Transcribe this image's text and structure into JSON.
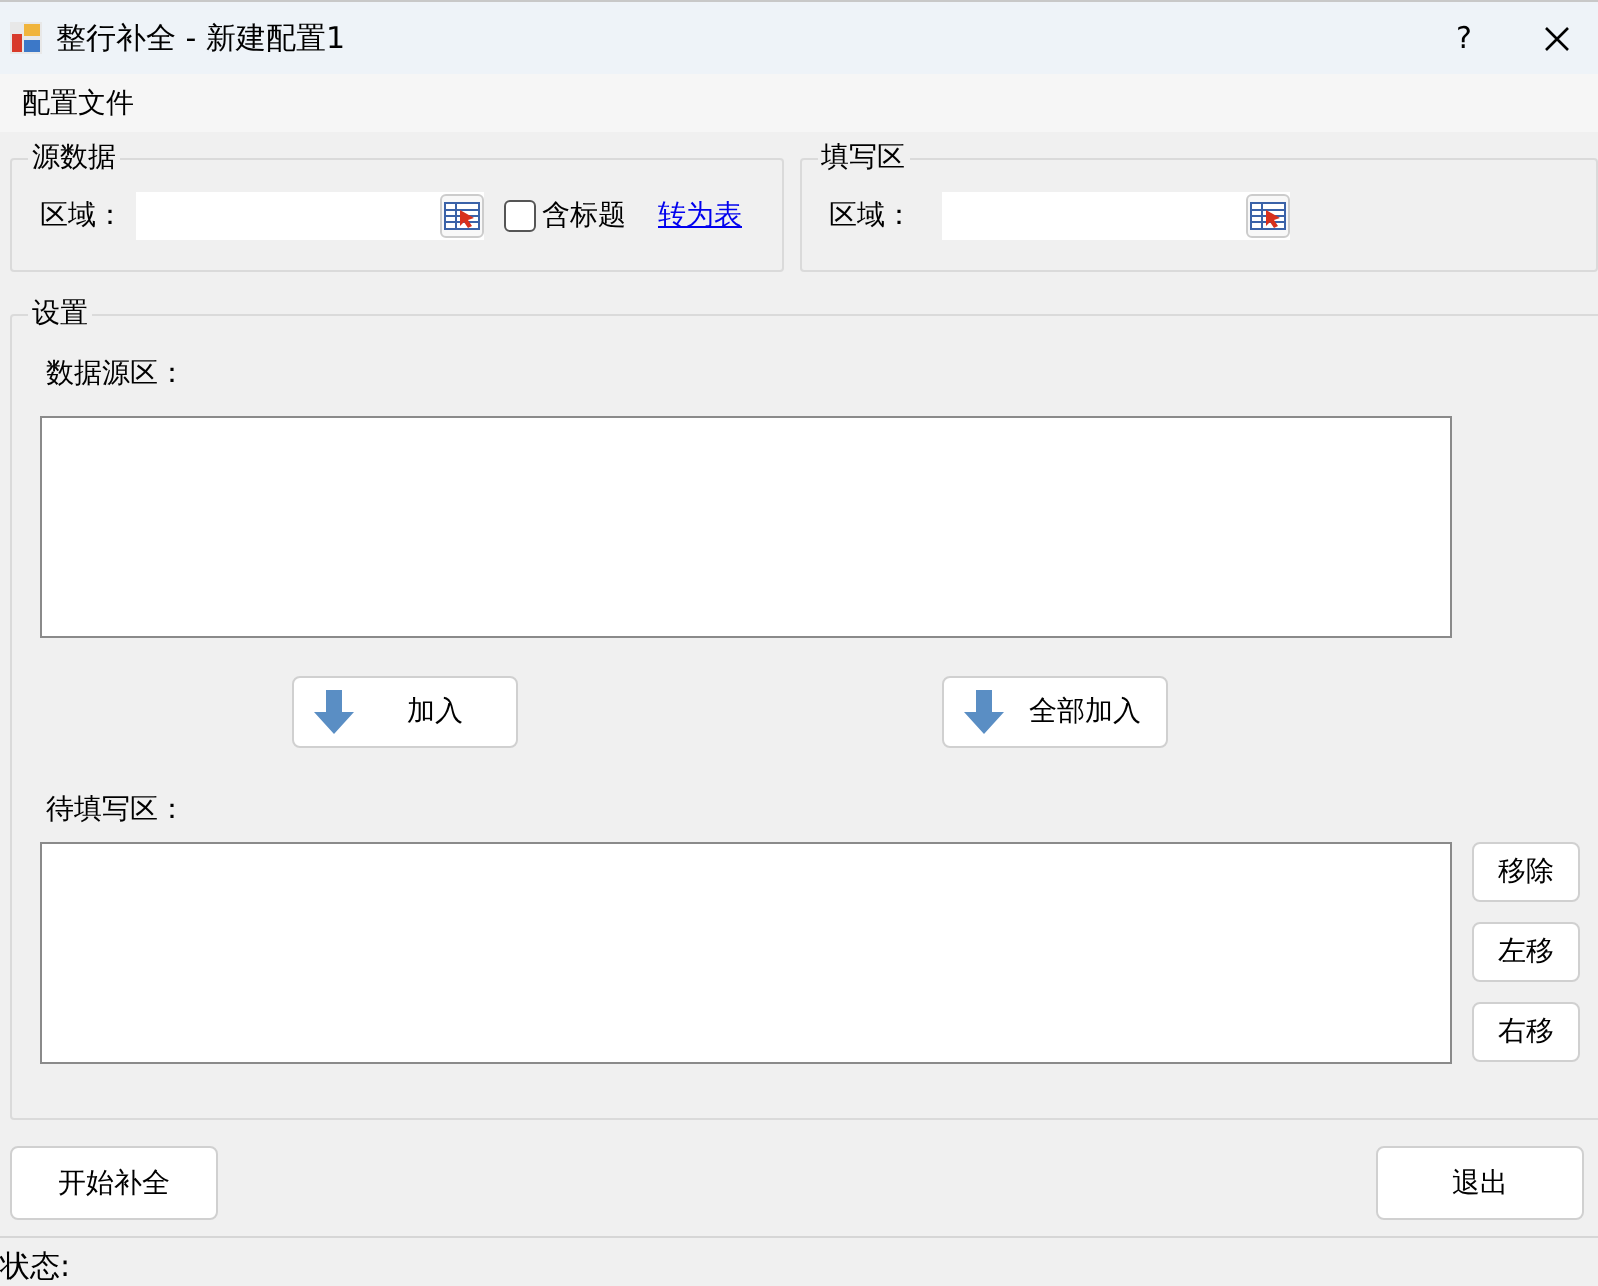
{
  "window": {
    "title": "整行补全 - 新建配置1",
    "help": "?"
  },
  "menu": [
    {
      "label": "配置文件"
    }
  ],
  "source": {
    "title": "源数据",
    "range_label": "区域：",
    "header_checkbox": {
      "label": "含标题",
      "checked": false
    },
    "link": "转为表"
  },
  "fill": {
    "title": "填写区",
    "range_label": "区域："
  },
  "settings": {
    "title": "设置",
    "source_label": "数据源区：",
    "add_buttons": [
      "加入",
      "全部加入"
    ],
    "pending_label": "待填写区：",
    "side_buttons": [
      "移除",
      "左移",
      "右移"
    ]
  },
  "actions": [
    "开始补全",
    "退出"
  ],
  "status_bar": {
    "label": "状态:"
  }
}
